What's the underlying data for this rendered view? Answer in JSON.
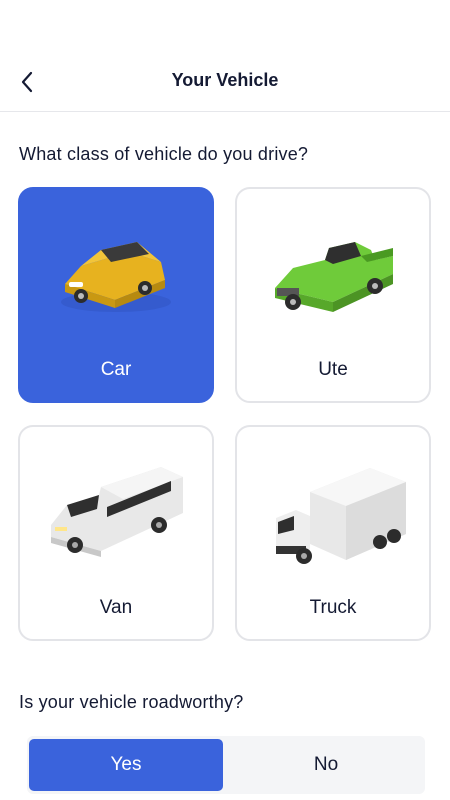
{
  "header": {
    "title": "Your Vehicle",
    "back_icon": "chevron-left-icon"
  },
  "vehicle_class": {
    "question": "What class of vehicle do you drive?",
    "selected": "Car",
    "options": [
      {
        "label": "Car",
        "icon": "car-icon",
        "color": "#e7b21f"
      },
      {
        "label": "Ute",
        "icon": "ute-icon",
        "color": "#6fcb3a"
      },
      {
        "label": "Van",
        "icon": "van-icon",
        "color": "#e8e8e8"
      },
      {
        "label": "Truck",
        "icon": "truck-icon",
        "color": "#e8e8e8"
      }
    ]
  },
  "roadworthy": {
    "question": "Is your vehicle roadworthy?",
    "selected": "Yes",
    "options": [
      {
        "label": "Yes"
      },
      {
        "label": "No"
      }
    ]
  },
  "colors": {
    "accent": "#3a63dc",
    "text": "#141a33",
    "border": "#e3e4e8"
  }
}
